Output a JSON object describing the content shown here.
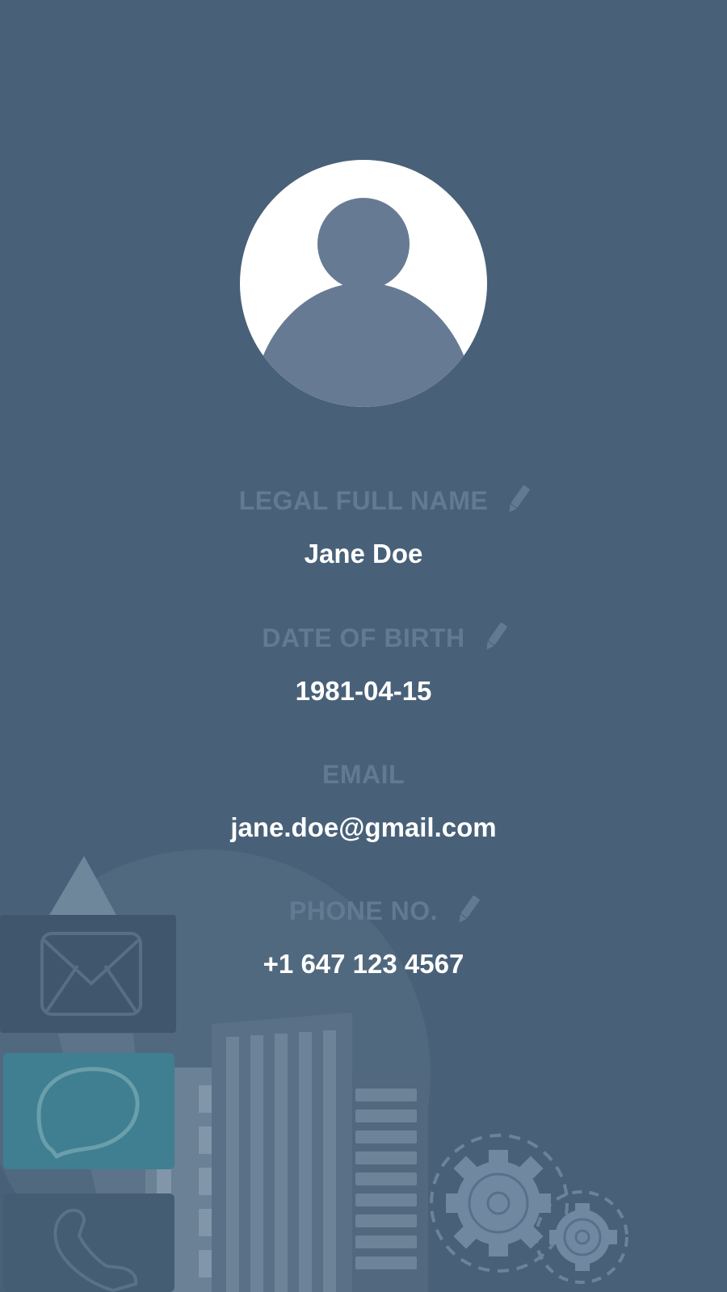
{
  "colors": {
    "background": "#486178",
    "label": "#627a92",
    "value": "#ffffff",
    "avatar_bg": "#ffffff",
    "avatar_figure": "#667b93",
    "chat_accent": "#3f7f91"
  },
  "avatar": {
    "icon": "person-silhouette-icon"
  },
  "fields": [
    {
      "label": "LEGAL FULL NAME",
      "value": "Jane Doe",
      "editable": true,
      "icon": "pencil-icon"
    },
    {
      "label": "DATE OF BIRTH",
      "value": "1981-04-15",
      "editable": true,
      "icon": "pencil-icon"
    },
    {
      "label": "EMAIL",
      "value": "jane.doe@gmail.com",
      "editable": false
    },
    {
      "label": "PHONE NO.",
      "value": "+1 647 123 4567",
      "editable": true,
      "icon": "pencil-icon"
    }
  ],
  "background_illustration": {
    "icons": [
      "envelope-icon",
      "chat-bubble-icon",
      "phone-icon",
      "gear-icon",
      "building-icon",
      "rocket-icon"
    ]
  }
}
